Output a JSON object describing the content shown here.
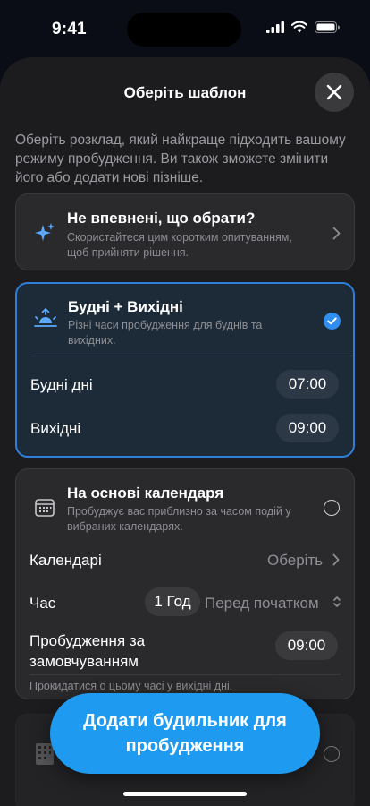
{
  "status_bar": {
    "time": "9:41"
  },
  "sheet": {
    "title": "Оберіть шаблон",
    "intro": "Оберіть розклад, який найкраще підходить вашому режиму пробудження. Ви також зможете змінити його або додати нові пізніше."
  },
  "cards": {
    "unsure": {
      "title": "Не впевнені, що обрати?",
      "subtitle": "Скористайтеся цим коротким опитуванням, щоб прийняти рішення."
    },
    "weekday_weekend": {
      "title": "Будні + Вихідні",
      "subtitle": "Різні часи пробудження для буднів та вихідних.",
      "rows": [
        {
          "label": "Будні дні",
          "value": "07:00"
        },
        {
          "label": "Вихідні",
          "value": "09:00"
        }
      ]
    },
    "calendar": {
      "title": "На основі календаря",
      "subtitle": "Пробуджує вас приблизно за часом подій у вибраних календарях.",
      "calendars_label": "Календарі",
      "calendars_value": "Оберіть",
      "time_label": "Час",
      "time_offset": "1 Год",
      "time_relation": "Перед початком",
      "default_wake_label_1": "Пробудження за",
      "default_wake_label_2": "замовчуванням",
      "default_wake_value": "09:00",
      "note": "Прокидатися о цьому часі у вихідні дні."
    }
  },
  "cta": {
    "label": "Додати будильник для пробудження"
  },
  "colors": {
    "accent": "#1e9bf0",
    "selected_border": "#2f7fd8",
    "sheet_bg": "#1c1c1e"
  }
}
